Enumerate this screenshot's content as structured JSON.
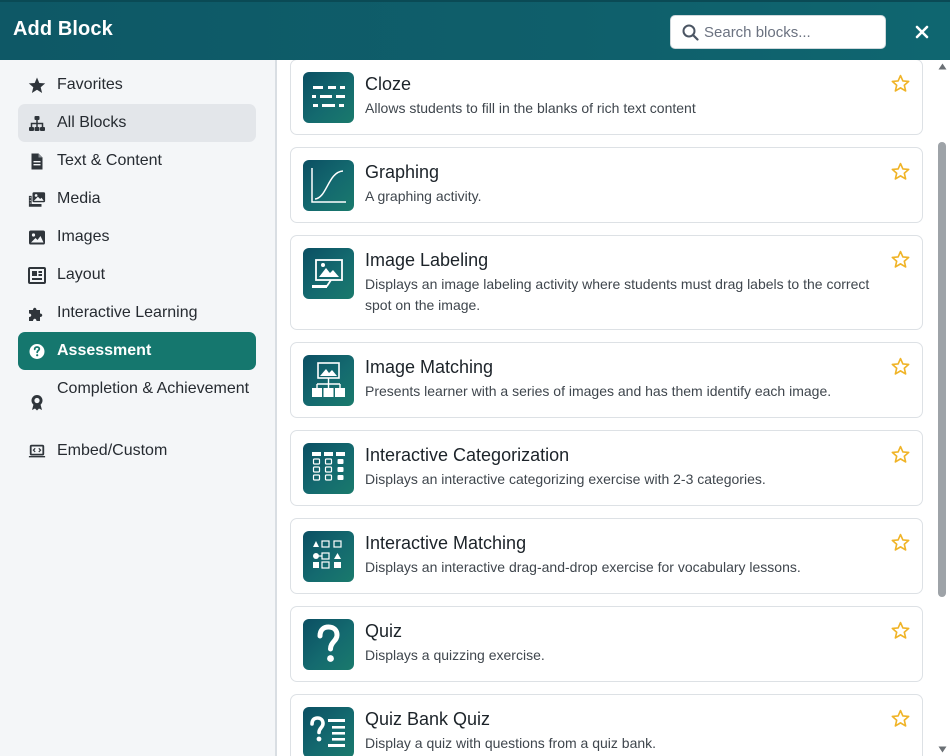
{
  "header": {
    "title": "Add Block",
    "search_placeholder": "Search blocks...",
    "search_value": "",
    "search_icon": "search-icon",
    "close_icon": "close-icon"
  },
  "sidebar": {
    "items": [
      {
        "label": "Favorites",
        "icon": "star-icon",
        "state": "normal"
      },
      {
        "label": "All Blocks",
        "icon": "sitemap-icon",
        "state": "selected"
      },
      {
        "label": "Text & Content",
        "icon": "document-icon",
        "state": "normal"
      },
      {
        "label": "Media",
        "icon": "photo-film-icon",
        "state": "normal"
      },
      {
        "label": "Images",
        "icon": "image-icon",
        "state": "normal"
      },
      {
        "label": "Layout",
        "icon": "layout-icon",
        "state": "normal"
      },
      {
        "label": "Interactive Learning",
        "icon": "puzzle-icon",
        "state": "normal"
      },
      {
        "label": "Assessment",
        "icon": "question-circle-icon",
        "state": "active"
      },
      {
        "label": "Completion & Achievement",
        "icon": "award-icon",
        "state": "normal"
      },
      {
        "label": "Embed/Custom",
        "icon": "code-laptop-icon",
        "state": "normal"
      }
    ]
  },
  "blocks": [
    {
      "title": "Cloze",
      "description": "Allows students to fill in the blanks of rich text content",
      "icon": "cloze-icon"
    },
    {
      "title": "Graphing",
      "description": "A graphing activity.",
      "icon": "graph-curve-icon"
    },
    {
      "title": "Image Labeling",
      "description": "Displays an image labeling activity where students must drag labels to the correct spot on the image.",
      "icon": "image-label-icon"
    },
    {
      "title": "Image Matching",
      "description": "Presents learner with a series of images and has them identify each image.",
      "icon": "image-match-icon"
    },
    {
      "title": "Interactive Categorization",
      "description": "Displays an interactive categorizing exercise with 2-3 categories.",
      "icon": "categorization-icon"
    },
    {
      "title": "Interactive Matching",
      "description": "Displays an interactive drag-and-drop exercise for vocabulary lessons.",
      "icon": "matching-icon"
    },
    {
      "title": "Quiz",
      "description": "Displays a quizzing exercise.",
      "icon": "question-mark-icon"
    },
    {
      "title": "Quiz Bank Quiz",
      "description": "Display a quiz with questions from a quiz bank.",
      "icon": "quiz-bank-icon"
    }
  ],
  "favorite_icon": "star-outline-icon",
  "colors": {
    "header": "#0f5f6b",
    "active_nav": "#15776e",
    "selected_nav": "#e3e6ea",
    "star": "#f0b428"
  }
}
